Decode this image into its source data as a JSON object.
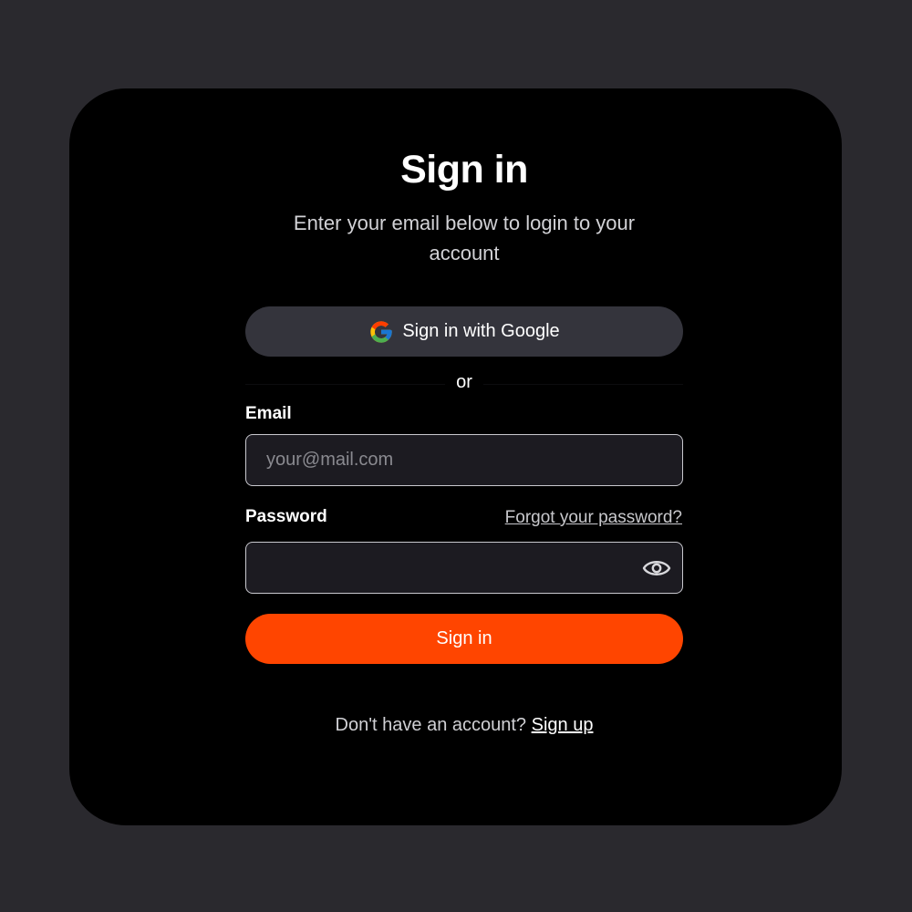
{
  "header": {
    "title": "Sign in",
    "subtitle": "Enter your email below to login to your account"
  },
  "google": {
    "label": "Sign in with Google",
    "icon": "google-icon"
  },
  "divider": {
    "text": "or"
  },
  "email": {
    "label": "Email",
    "placeholder": "your@mail.com",
    "value": ""
  },
  "password": {
    "label": "Password",
    "forgot_label": "Forgot your password?",
    "value": "",
    "toggle_icon": "eye-icon"
  },
  "submit": {
    "label": "Sign in"
  },
  "footer": {
    "prompt": "Don't have an account?",
    "signup_label": "Sign up"
  },
  "colors": {
    "page_background": "#2a292e",
    "card_background": "#000000",
    "accent": "#ff4500",
    "google_button": "#34343c",
    "input_background": "#1c1b21"
  }
}
